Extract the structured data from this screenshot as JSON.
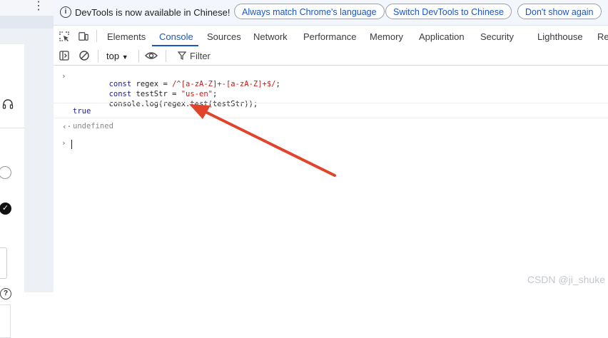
{
  "infobar": {
    "message": "DevTools is now available in Chinese!",
    "buttons": [
      "Always match Chrome's language",
      "Switch DevTools to Chinese",
      "Don't show again"
    ]
  },
  "tabs": [
    "Elements",
    "Console",
    "Sources",
    "Network",
    "Performance",
    "Memory",
    "Application",
    "Security",
    "Lighthouse",
    "Re"
  ],
  "active_tab": "Console",
  "toolbar": {
    "context": "top",
    "filter_label": "Filter"
  },
  "console": {
    "input_lines": [
      [
        {
          "t": "const",
          "c": "kw"
        },
        {
          "t": " regex = ",
          "c": "tok"
        },
        {
          "t": "/^[a-zA-Z]+-[a-zA-Z]+$/",
          "c": "str"
        },
        {
          "t": ";",
          "c": "tok"
        }
      ],
      [
        {
          "t": "const",
          "c": "kw"
        },
        {
          "t": " testStr = ",
          "c": "tok"
        },
        {
          "t": "\"us-en\"",
          "c": "str"
        },
        {
          "t": ";",
          "c": "tok"
        }
      ],
      [
        {
          "t": "console.log(regex.test(testStr));",
          "c": "tok"
        }
      ]
    ],
    "log_output": "true",
    "return_value": "undefined"
  },
  "watermark": "CSDN @ji_shuke",
  "colors": {
    "accent": "#1a56c8",
    "arrow": "#e2432b"
  }
}
